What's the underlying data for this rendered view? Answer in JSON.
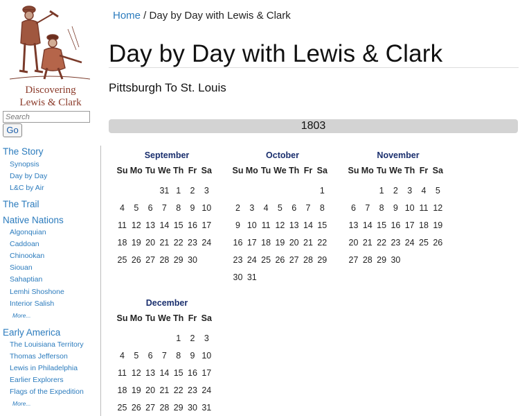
{
  "logo": {
    "line1": "Discovering",
    "line2": "Lewis & Clark"
  },
  "search": {
    "placeholder": "Search",
    "go_label": "Go"
  },
  "nav": {
    "sections": [
      {
        "label": "The Story",
        "items": [
          "Synopsis",
          "Day by Day",
          "L&C by Air"
        ]
      },
      {
        "label": "The Trail",
        "items": []
      },
      {
        "label": "Native Nations",
        "items": [
          "Algonquian",
          "Caddoan",
          "Chinookan",
          "Siouan",
          "Sahaptian",
          "Lemhi Shoshone",
          "Interior Salish"
        ],
        "more": "More..."
      },
      {
        "label": "Early America",
        "items": [
          "The Louisiana Territory",
          "Thomas Jefferson",
          "Lewis in Philadelphia",
          "Earlier Explorers",
          "Flags of the Expedition"
        ],
        "more": "More..."
      }
    ]
  },
  "breadcrumb": {
    "home": "Home",
    "separator": " / ",
    "current": "Day by Day with Lewis & Clark"
  },
  "page": {
    "title": "Day by Day with Lewis & Clark",
    "subtitle": "Pittsburgh To St. Louis",
    "year": "1803"
  },
  "weekdays": [
    "Su",
    "Mo",
    "Tu",
    "We",
    "Th",
    "Fr",
    "Sa"
  ],
  "months": [
    {
      "name": "September",
      "weeks": [
        [
          "",
          "",
          "",
          "31",
          "1",
          "2",
          "3"
        ],
        [
          "4",
          "5",
          "6",
          "7",
          "8",
          "9",
          "10"
        ],
        [
          "11",
          "12",
          "13",
          "14",
          "15",
          "16",
          "17"
        ],
        [
          "18",
          "19",
          "20",
          "21",
          "22",
          "23",
          "24"
        ],
        [
          "25",
          "26",
          "27",
          "28",
          "29",
          "30",
          ""
        ]
      ]
    },
    {
      "name": "October",
      "weeks": [
        [
          "",
          "",
          "",
          "",
          "",
          "",
          "1"
        ],
        [
          "2",
          "3",
          "4",
          "5",
          "6",
          "7",
          "8"
        ],
        [
          "9",
          "10",
          "11",
          "12",
          "13",
          "14",
          "15"
        ],
        [
          "16",
          "17",
          "18",
          "19",
          "20",
          "21",
          "22"
        ],
        [
          "23",
          "24",
          "25",
          "26",
          "27",
          "28",
          "29"
        ],
        [
          "30",
          "31",
          "",
          "",
          "",
          "",
          ""
        ]
      ]
    },
    {
      "name": "November",
      "weeks": [
        [
          "",
          "",
          "1",
          "2",
          "3",
          "4",
          "5"
        ],
        [
          "6",
          "7",
          "8",
          "9",
          "10",
          "11",
          "12"
        ],
        [
          "13",
          "14",
          "15",
          "16",
          "17",
          "18",
          "19"
        ],
        [
          "20",
          "21",
          "22",
          "23",
          "24",
          "25",
          "26"
        ],
        [
          "27",
          "28",
          "29",
          "30",
          "",
          "",
          ""
        ]
      ]
    },
    {
      "name": "December",
      "weeks": [
        [
          "",
          "",
          "",
          "",
          "",
          "1",
          "2",
          "3"
        ],
        [
          "4",
          "5",
          "6",
          "7",
          "8",
          "9",
          "10"
        ],
        [
          "11",
          "12",
          "13",
          "14",
          "15",
          "16",
          "17"
        ],
        [
          "18",
          "19",
          "20",
          "21",
          "22",
          "23",
          "24"
        ],
        [
          "25",
          "26",
          "27",
          "28",
          "29",
          "30",
          "31"
        ]
      ]
    }
  ]
}
